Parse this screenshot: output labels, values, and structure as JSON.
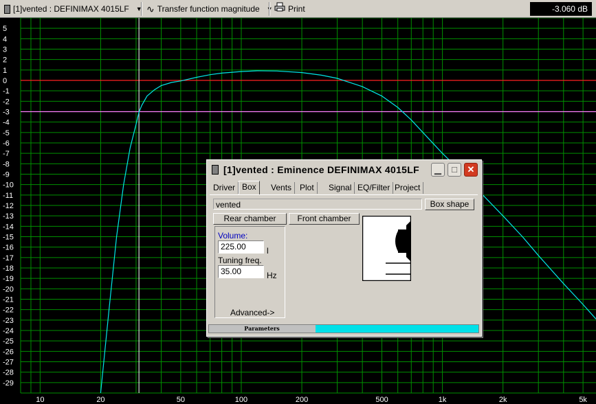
{
  "toolbar": {
    "project_label": "[1]vented : DEFINIMAX 4015LF",
    "view_label": "Transfer function magnitude",
    "print_label": "Print",
    "readout": "-3.060 dB"
  },
  "chart_data": {
    "type": "line",
    "xlabel": "",
    "ylabel": "",
    "x_scale": "log",
    "xlim": [
      8,
      5800
    ],
    "ylim": [
      -30,
      6
    ],
    "x_ticks": [
      "10",
      "20",
      "50",
      "100",
      "200",
      "500",
      "1k",
      "2k",
      "5k"
    ],
    "y_ticks": [
      "5",
      "4",
      "3",
      "2",
      "1",
      "0",
      "-1",
      "-2",
      "-3",
      "-4",
      "-5",
      "-6",
      "-7",
      "-8",
      "-9",
      "-10",
      "-11",
      "-12",
      "-13",
      "-14",
      "-15",
      "-16",
      "-17",
      "-18",
      "-19",
      "-20",
      "-21",
      "-22",
      "-23",
      "-24",
      "-25",
      "-26",
      "-27",
      "-28",
      "-29"
    ],
    "grid": true,
    "reference_lines": [
      {
        "y": 0,
        "color": "#ff2020"
      },
      {
        "y": -3,
        "color": "#ff80ff"
      }
    ],
    "cursor_x": 31,
    "series": [
      {
        "color": "#00e8e8",
        "points": [
          [
            20,
            -30
          ],
          [
            22,
            -22
          ],
          [
            24,
            -15
          ],
          [
            26,
            -10
          ],
          [
            28,
            -6.5
          ],
          [
            30,
            -4.2
          ],
          [
            31,
            -3.06
          ],
          [
            32,
            -2.4
          ],
          [
            34,
            -1.5
          ],
          [
            37,
            -0.9
          ],
          [
            40,
            -0.5
          ],
          [
            45,
            -0.2
          ],
          [
            50,
            -0.05
          ],
          [
            60,
            0.3
          ],
          [
            70,
            0.55
          ],
          [
            80,
            0.7
          ],
          [
            100,
            0.85
          ],
          [
            120,
            0.92
          ],
          [
            150,
            0.9
          ],
          [
            200,
            0.75
          ],
          [
            250,
            0.5
          ],
          [
            300,
            0.2
          ],
          [
            400,
            -0.6
          ],
          [
            500,
            -1.5
          ],
          [
            600,
            -2.6
          ],
          [
            700,
            -3.8
          ],
          [
            800,
            -5.0
          ],
          [
            1000,
            -7.0
          ],
          [
            1200,
            -8.5
          ],
          [
            1500,
            -10.5
          ],
          [
            2000,
            -13.0
          ],
          [
            2500,
            -15.0
          ],
          [
            3000,
            -16.8
          ],
          [
            4000,
            -19.5
          ],
          [
            5000,
            -21.5
          ],
          [
            5800,
            -22.9
          ]
        ]
      }
    ]
  },
  "dialog": {
    "title": "[1]vented : Eminence DEFINIMAX 4015LF",
    "tabs": [
      "Driver",
      "Box",
      "Vents",
      "Plot",
      "Signal",
      "EQ/Filter",
      "Project"
    ],
    "active_tab": "Box",
    "box_name": "vented",
    "box_shape_label": "Box shape",
    "rear_chamber_label": "Rear chamber",
    "front_chamber_label": "Front chamber",
    "volume_label": "Volume:",
    "volume_value": "225.00",
    "volume_unit": "l",
    "tuning_label": "Tuning freq.",
    "tuning_value": "35.00",
    "tuning_unit": "Hz",
    "advanced_label": "Advanced->",
    "status_label": "Parameters",
    "status_progress": 1.0
  },
  "colors": {
    "grid": "#009000",
    "curve": "#00e8e8",
    "zero_line": "#ff2020",
    "minus3_line": "#ff80ff",
    "cursor": "#ffffff",
    "progress": "#00e0e8",
    "volume_label": "#0000c0"
  },
  "icons": [
    "project-icon",
    "transfer-function-icon",
    "print-icon",
    "window-icon",
    "minimize-icon",
    "maximize-icon",
    "close-icon"
  ]
}
